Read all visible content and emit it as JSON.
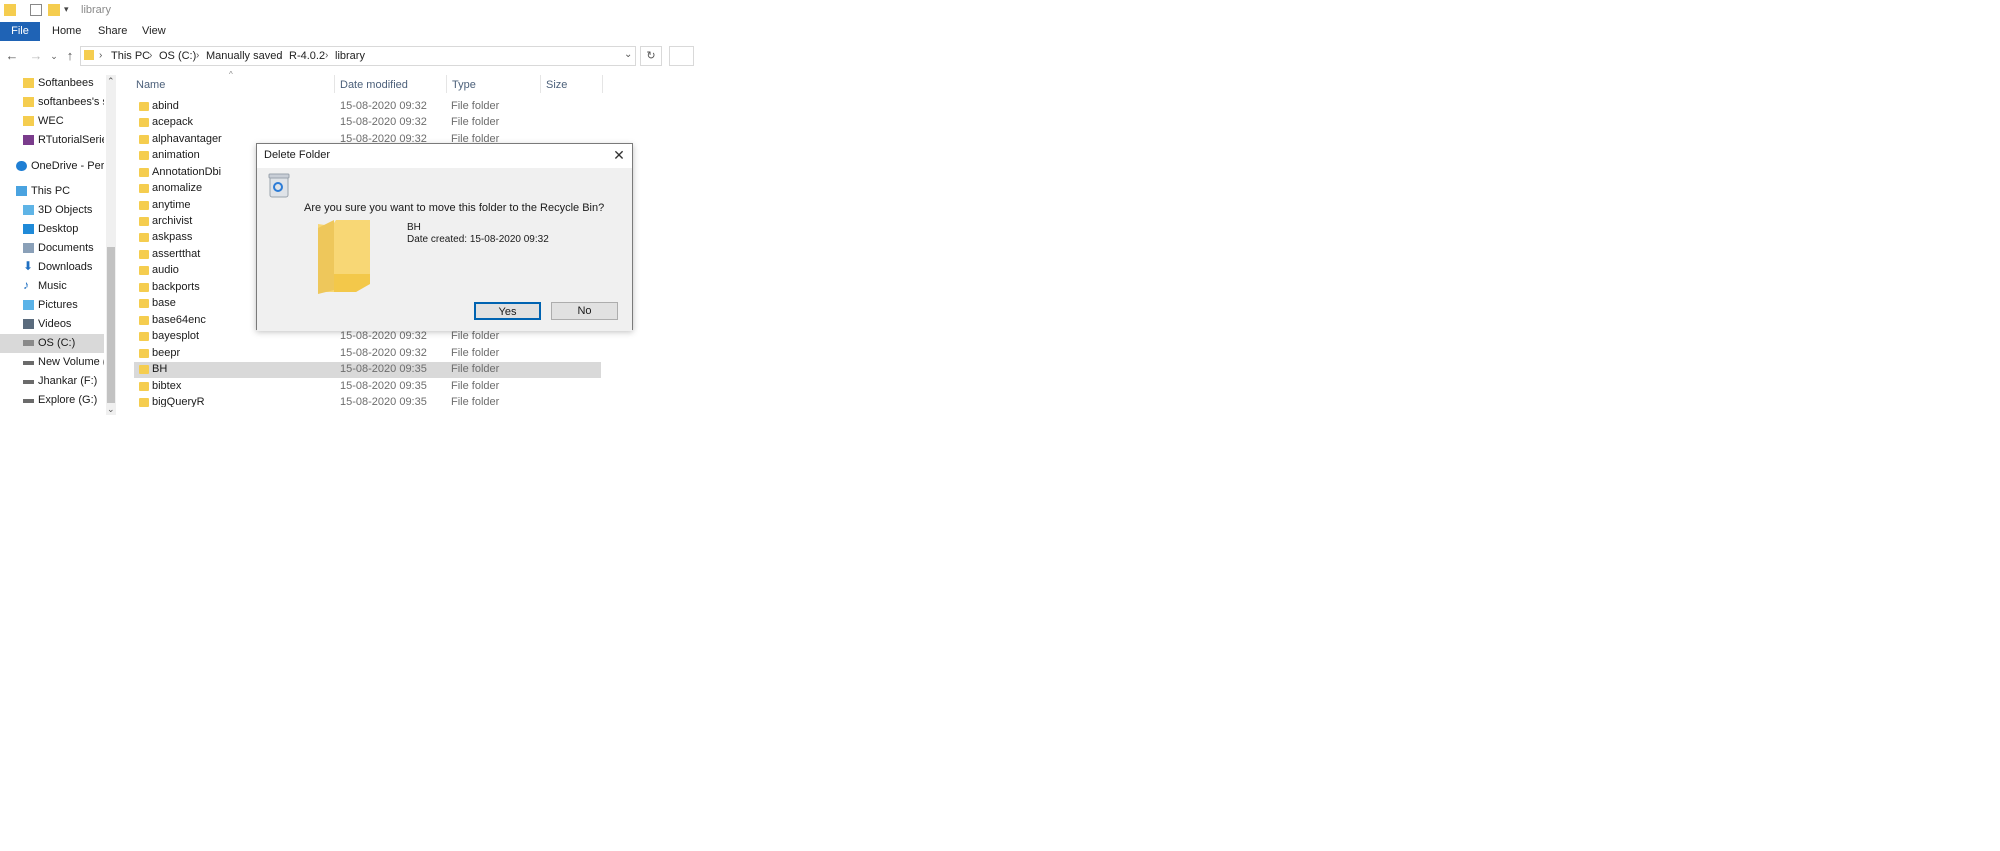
{
  "window": {
    "title": "library"
  },
  "ribbon": {
    "tabs": [
      "File",
      "Home",
      "Share",
      "View"
    ]
  },
  "address": {
    "crumbs": [
      "This PC",
      "OS (C:)",
      "Manually saved",
      "R-4.0.2",
      "library"
    ]
  },
  "nav_pane": {
    "items": [
      {
        "label": "Softanbees",
        "icon": "folder-icon"
      },
      {
        "label": "softanbees's sha",
        "icon": "folder-icon"
      },
      {
        "label": "WEC",
        "icon": "folder-icon"
      },
      {
        "label": "RTutorialSeries_F",
        "icon": "archive-icon"
      },
      {
        "label": "OneDrive - Person",
        "icon": "cloud-icon"
      },
      {
        "label": "This PC",
        "icon": "computer-icon"
      },
      {
        "label": "3D Objects",
        "icon": "cube-icon"
      },
      {
        "label": "Desktop",
        "icon": "desktop-icon"
      },
      {
        "label": "Documents",
        "icon": "documents-icon"
      },
      {
        "label": "Downloads",
        "icon": "download-icon"
      },
      {
        "label": "Music",
        "icon": "music-icon"
      },
      {
        "label": "Pictures",
        "icon": "pictures-icon"
      },
      {
        "label": "Videos",
        "icon": "videos-icon"
      },
      {
        "label": "OS (C:)",
        "icon": "drive-icon"
      },
      {
        "label": "New Volume (D:",
        "icon": "drive-icon"
      },
      {
        "label": "Jhankar (F:)",
        "icon": "drive-icon"
      },
      {
        "label": "Explore (G:)",
        "icon": "drive-icon"
      }
    ],
    "selected": "OS (C:)"
  },
  "file_list": {
    "columns": [
      "Name",
      "Date modified",
      "Type",
      "Size"
    ],
    "rows": [
      {
        "name": "abind",
        "date": "15-08-2020 09:32",
        "type": "File folder"
      },
      {
        "name": "acepack",
        "date": "15-08-2020 09:32",
        "type": "File folder"
      },
      {
        "name": "alphavantager",
        "date": "15-08-2020 09:32",
        "type": "File folder"
      },
      {
        "name": "animation",
        "date": "",
        "type": ""
      },
      {
        "name": "AnnotationDbi",
        "date": "",
        "type": ""
      },
      {
        "name": "anomalize",
        "date": "",
        "type": ""
      },
      {
        "name": "anytime",
        "date": "",
        "type": ""
      },
      {
        "name": "archivist",
        "date": "",
        "type": ""
      },
      {
        "name": "askpass",
        "date": "",
        "type": ""
      },
      {
        "name": "assertthat",
        "date": "",
        "type": ""
      },
      {
        "name": "audio",
        "date": "",
        "type": ""
      },
      {
        "name": "backports",
        "date": "",
        "type": ""
      },
      {
        "name": "base",
        "date": "",
        "type": ""
      },
      {
        "name": "base64enc",
        "date": "",
        "type": ""
      },
      {
        "name": "bayesplot",
        "date": "15-08-2020 09:32",
        "type": "File folder"
      },
      {
        "name": "beepr",
        "date": "15-08-2020 09:32",
        "type": "File folder"
      },
      {
        "name": "BH",
        "date": "15-08-2020 09:35",
        "type": "File folder"
      },
      {
        "name": "bibtex",
        "date": "15-08-2020 09:35",
        "type": "File folder"
      },
      {
        "name": "bigQueryR",
        "date": "15-08-2020 09:35",
        "type": "File folder"
      }
    ],
    "selected": "BH"
  },
  "dialog": {
    "title": "Delete Folder",
    "message": "Are you sure you want to move this folder to the Recycle Bin?",
    "item_name": "BH",
    "item_date": "Date created: 15-08-2020 09:32",
    "yes_label": "Yes",
    "no_label": "No",
    "close_glyph": "✕"
  },
  "colors": {
    "accent": "#1f63b5",
    "selection": "#d9d9d9",
    "folder": "#f5cd4f"
  }
}
